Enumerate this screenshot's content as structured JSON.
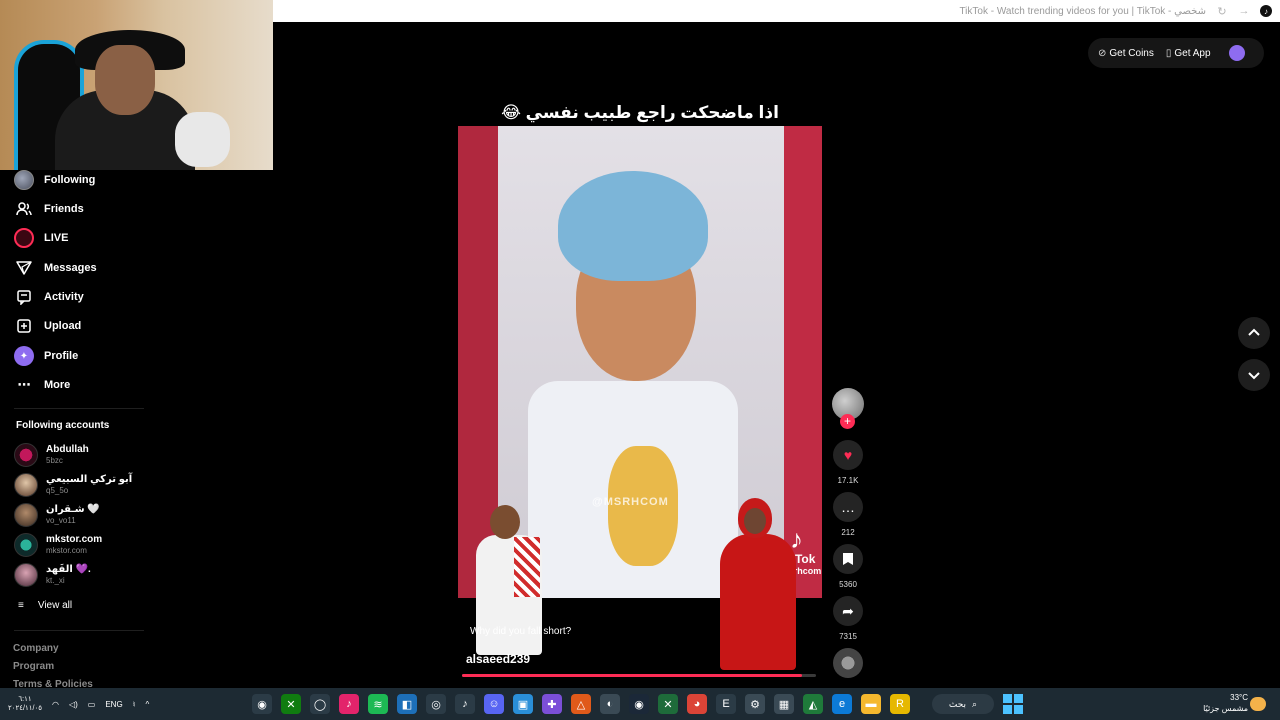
{
  "browser": {
    "window_title": "TikTok - Watch trending videos for you | TikTok - شخصي"
  },
  "sidebar": {
    "nav": [
      {
        "label": "Following",
        "icon": "following-avatar-icon"
      },
      {
        "label": "Friends",
        "icon": "friends-icon"
      },
      {
        "label": "LIVE",
        "icon": "live-icon"
      },
      {
        "label": "Messages",
        "icon": "messages-icon"
      },
      {
        "label": "Activity",
        "icon": "activity-icon"
      },
      {
        "label": "Upload",
        "icon": "upload-icon"
      },
      {
        "label": "Profile",
        "icon": "profile-icon"
      },
      {
        "label": "More",
        "icon": "more-icon"
      }
    ],
    "following_title": "Following accounts",
    "accounts": [
      {
        "name": "Abdullah",
        "handle": "5bzc"
      },
      {
        "name": "آبو تركي السبيعي",
        "handle": "q5_5o"
      },
      {
        "name": "شـقران 🤍",
        "handle": "vo_vo11"
      },
      {
        "name": "mkstor.com",
        "handle": "mkstor.com"
      },
      {
        "name": "الفَهد 💜.",
        "handle": "kt._xi"
      }
    ],
    "view_all": "View all",
    "footer": [
      "Company",
      "Program",
      "Terms & Policies"
    ]
  },
  "header": {
    "get_coins": "Get Coins",
    "get_app": "Get App"
  },
  "video": {
    "overlay_caption": "اذا ماضحكت راجع طبيب نفسي 😂",
    "watermark": "@MSRHCOM",
    "tiktok_brand": "TikTok",
    "tiktok_user": "@msrhcom",
    "question": "Why did you fall short?",
    "author": "alsaeed239",
    "progress": 0.96
  },
  "actions": {
    "likes": "17.1K",
    "comments": "212",
    "saves": "5360",
    "shares": "7315"
  },
  "taskbar": {
    "time": "٦:١١",
    "date": "٢٠٢٤/١١/٠٥",
    "lang": "ENG",
    "search": "بحث",
    "temp": "33°C",
    "weather": "مشمس جزئيًا"
  },
  "colors": {
    "accent": "#fe2c55",
    "profile": "#8e6cf0",
    "taskbar": "#1d2a33"
  }
}
